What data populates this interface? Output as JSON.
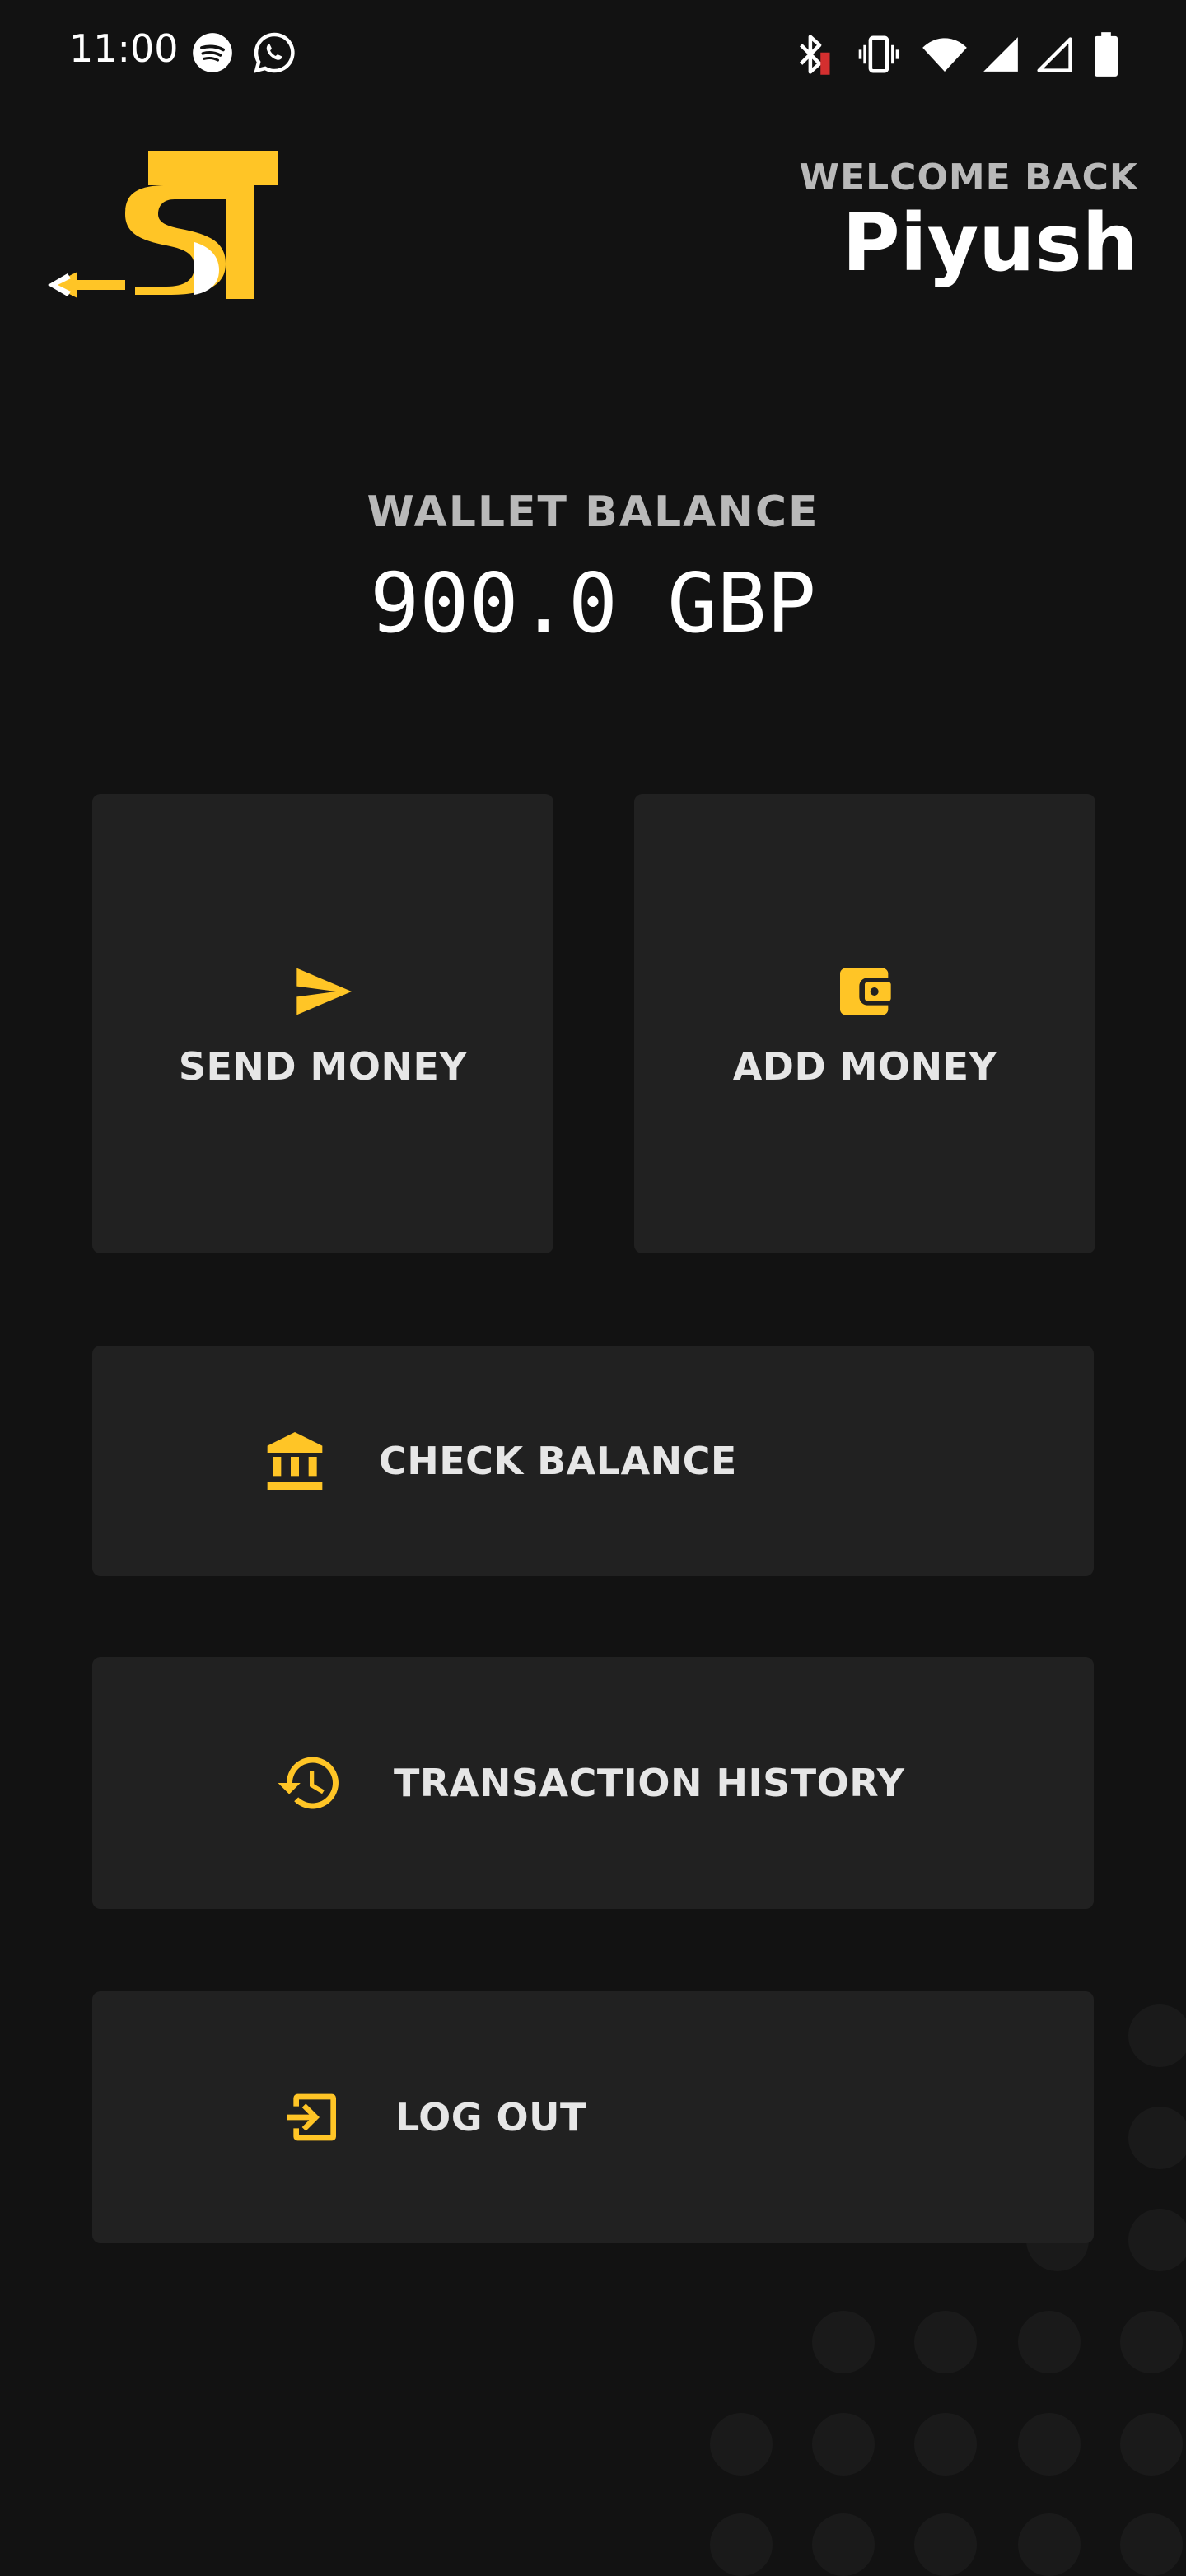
{
  "status_bar": {
    "time": "11:00",
    "left_icons": [
      "spotify-icon",
      "whatsapp-icon"
    ],
    "right_icons": [
      "bluetooth-icon",
      "vibrate-icon",
      "wifi-icon",
      "signal-icon",
      "signal-empty-icon",
      "battery-icon"
    ]
  },
  "header": {
    "welcome_label": "WELCOME BACK",
    "user_name": "Piyush"
  },
  "wallet": {
    "label": "WALLET BALANCE",
    "amount": "900.0 GBP"
  },
  "actions": {
    "send_money": {
      "label": "SEND MONEY",
      "icon": "send-icon"
    },
    "add_money": {
      "label": "ADD MONEY",
      "icon": "wallet-icon"
    },
    "check_balance": {
      "label": "CHECK BALANCE",
      "icon": "bank-icon"
    },
    "transaction_history": {
      "label": "TRANSACTION HISTORY",
      "icon": "history-icon"
    },
    "log_out": {
      "label": "LOG OUT",
      "icon": "logout-icon"
    }
  },
  "colors": {
    "background": "#121212",
    "card": "#212121",
    "accent": "#FFC526",
    "muted_text": "#B9B9B9"
  }
}
